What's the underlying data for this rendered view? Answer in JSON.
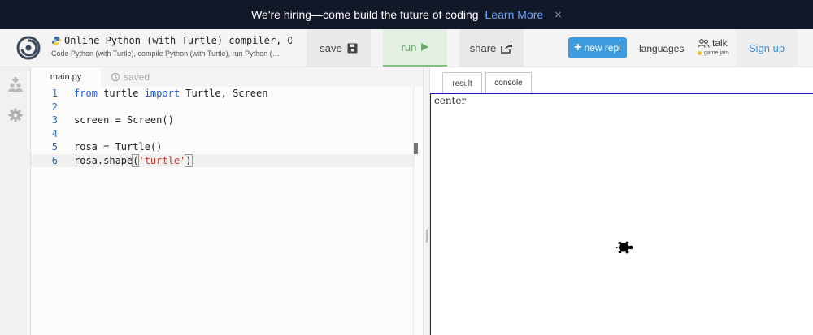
{
  "banner": {
    "message": "We're hiring—come build the future of coding",
    "link": "Learn More",
    "close": "×"
  },
  "header": {
    "title": "Online Python (with Turtle) compiler, On…",
    "subtitle": "Code Python (with Turtle), compile Python (with Turtle), run Python (…",
    "save": "save",
    "run": "run",
    "share": "share",
    "new_repl": "new repl",
    "languages": "languages",
    "talk": "talk",
    "talk_sub": "game jam",
    "signup": "Sign up"
  },
  "editor": {
    "file_tab": "main.py",
    "saved": "saved",
    "lines": [
      {
        "n": "1",
        "text": "from turtle import Turtle, Screen"
      },
      {
        "n": "2",
        "text": ""
      },
      {
        "n": "3",
        "text": "screen = Screen()"
      },
      {
        "n": "4",
        "text": ""
      },
      {
        "n": "5",
        "text": "rosa = Turtle()"
      },
      {
        "n": "6",
        "text": "rosa.shape('turtle')"
      }
    ]
  },
  "output": {
    "tabs": [
      "result",
      "console"
    ],
    "canvas_label": "center"
  },
  "colors": {
    "banner_bg": "#111827",
    "accent_blue": "#3d9ce0",
    "run_green": "#6aa86a",
    "keyword": "#1a56db",
    "string": "#c0392b"
  }
}
